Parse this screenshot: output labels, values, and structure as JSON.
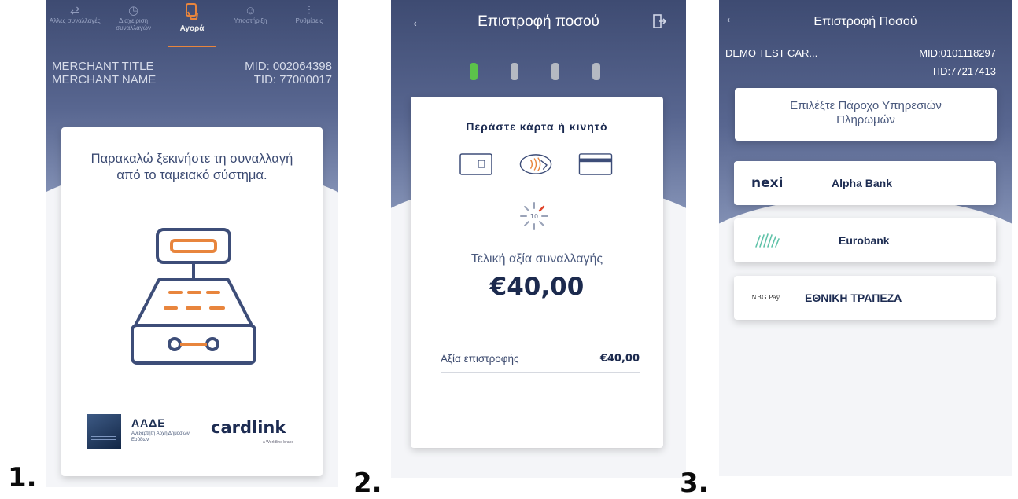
{
  "steps": [
    "1.",
    "2.",
    "3."
  ],
  "screen1": {
    "tabs": [
      {
        "label": "Άλλες συναλλαγές",
        "icon": "exchange-icon"
      },
      {
        "label": "Διαχείριση συναλλαγών",
        "icon": "clock-icon"
      },
      {
        "label": "Αγορά",
        "icon": "hand-card-icon",
        "active": true
      },
      {
        "label": "Υποστήριξη",
        "icon": "support-icon"
      },
      {
        "label": "Ρυθμίσεις",
        "icon": "settings-sliders-icon"
      }
    ],
    "merchant_title": "MERCHANT TITLE",
    "merchant_name": "MERCHANT NAME",
    "mid": "MID: 002064398",
    "tid": "TID: 77000017",
    "prompt_line1": "Παρακαλώ ξεκινήστε τη συναλλαγή",
    "prompt_line2": "από το ταμειακό σύστημα.",
    "aade_title": "ΑΑΔΕ",
    "aade_subtitle": "Ανεξάρτητη Αρχή Δημοσίων Εσόδων",
    "cardlink": "cardlink",
    "cardlink_sub": "a Worldline brand"
  },
  "screen2": {
    "title": "Επιστροφή ποσού",
    "progress": {
      "current": 1,
      "total": 4
    },
    "present_card": "Περάστε κάρτα ή κινητό",
    "timer": "10",
    "final_label": "Τελική αξία συναλλαγής",
    "amount": "€40,00",
    "refund_label": "Αξία επιστροφής",
    "refund_value": "€40,00"
  },
  "screen3": {
    "title": "Επιστροφή Ποσού",
    "merchant": "DEMO TEST CAR...",
    "mid": "MID:0101118297",
    "tid": "TID:77217413",
    "select_provider": "Επιλέξτε Πάροχο Υπηρεσιών Πληρωμών",
    "banks": [
      {
        "logo": "nexi",
        "name": "Alpha Bank"
      },
      {
        "logo": "",
        "name": "Eurobank"
      },
      {
        "logo": "NBG Pay",
        "name": "ΕΘΝΙΚΗ ΤΡΑΠΕΖΑ"
      }
    ]
  },
  "colors": {
    "header": "#4a5880",
    "accent_orange": "#e8853d",
    "progress_green": "#5cc24a",
    "navy": "#1d2c52"
  }
}
